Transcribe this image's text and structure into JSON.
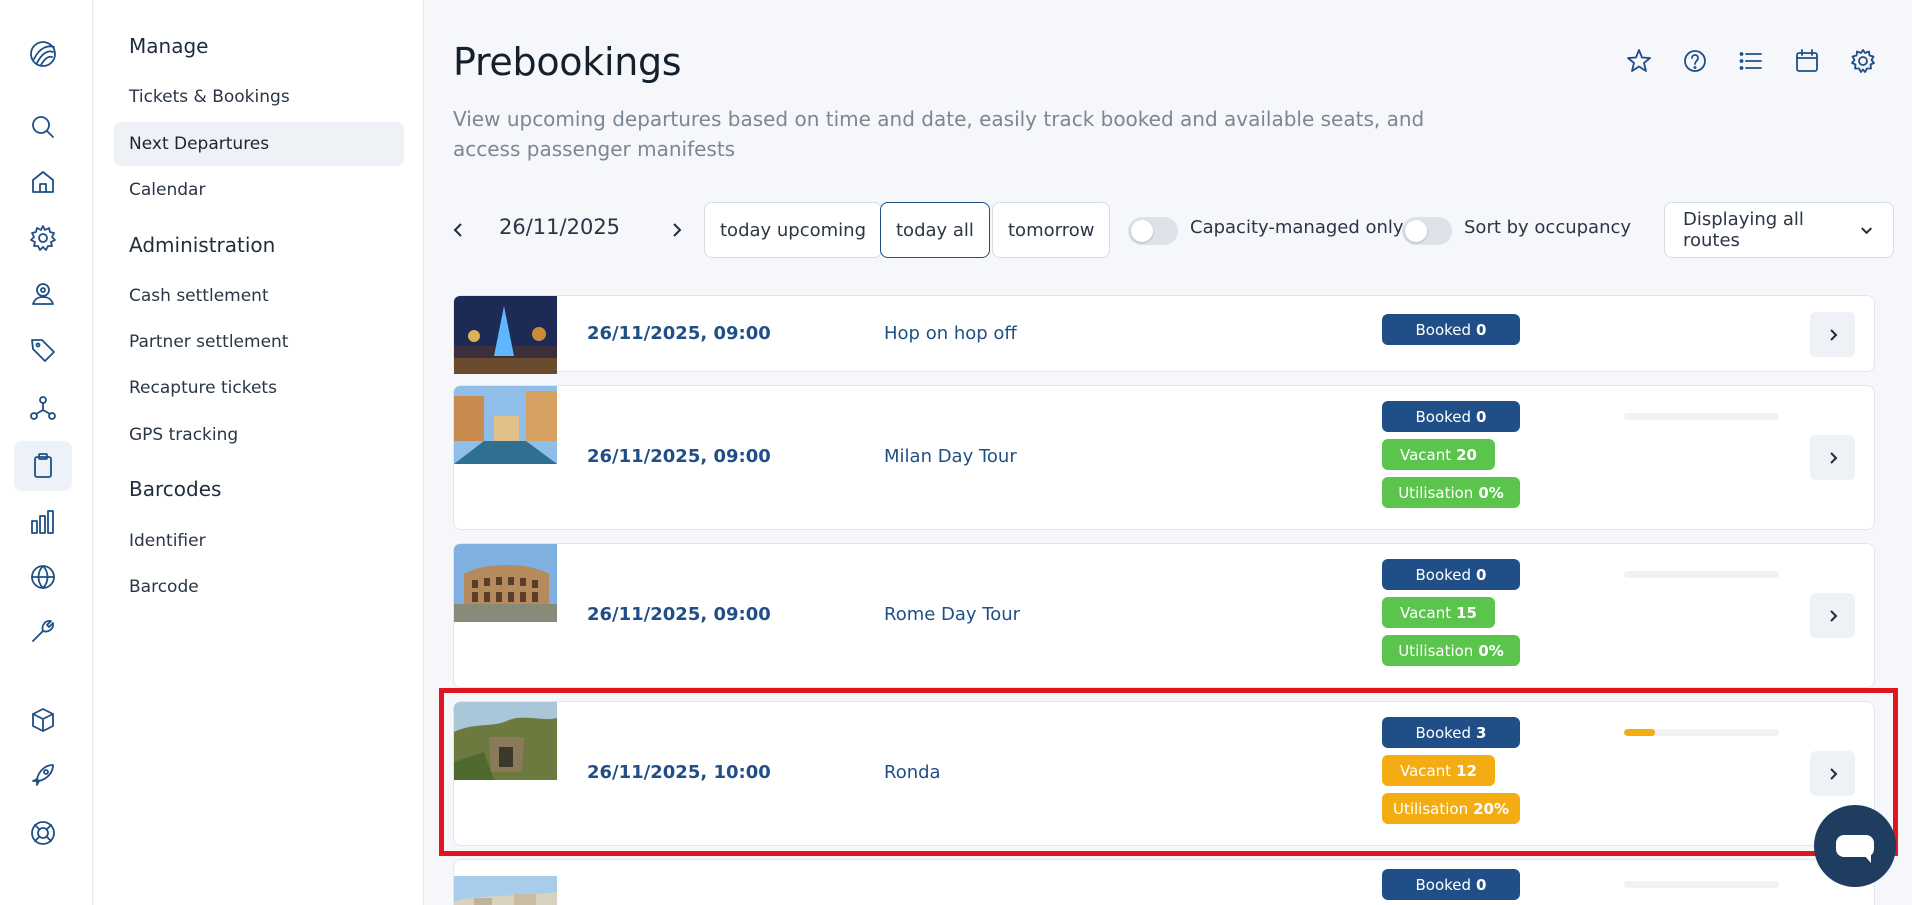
{
  "rail": {
    "icons": [
      "logo-icon",
      "search-icon",
      "home-icon",
      "gear-icon",
      "user-pin-icon",
      "tag-icon",
      "network-icon",
      "clipboard-icon",
      "bar-chart-icon",
      "globe-icon",
      "wrench-icon",
      "cube-icon",
      "rocket-icon",
      "lifebuoy-icon"
    ],
    "active": "clipboard-icon"
  },
  "sidebar": {
    "sections": [
      {
        "heading": "Manage",
        "items": [
          "Tickets & Bookings",
          "Next Departures",
          "Calendar"
        ]
      },
      {
        "heading": "Administration",
        "items": [
          "Cash settlement",
          "Partner settlement",
          "Recapture tickets",
          "GPS tracking"
        ]
      },
      {
        "heading": "Barcodes",
        "items": [
          "Identifier",
          "Barcode"
        ]
      }
    ],
    "active_item": "Next Departures"
  },
  "header": {
    "title": "Prebookings",
    "subtitle": "View upcoming departures based on time and date, easily track booked and available seats, and access passenger manifests",
    "icons": [
      "star-icon",
      "help-icon",
      "list-icon",
      "calendar-icon",
      "settings-icon"
    ]
  },
  "toolbar": {
    "date": "26/11/2025",
    "quick_buttons": [
      "today upcoming",
      "today all",
      "tomorrow"
    ],
    "selected_quick": "today all",
    "toggle_capacity": "Capacity-managed only",
    "toggle_sort": "Sort by occupancy",
    "route_select": "Displaying all routes"
  },
  "departures": [
    {
      "datetime": "26/11/2025, 09:00",
      "route": "Hop on hop off",
      "booked_label": "Booked",
      "booked": "0"
    },
    {
      "datetime": "26/11/2025, 09:00",
      "route": "Milan Day Tour",
      "booked_label": "Booked",
      "booked": "0",
      "vacant_label": "Vacant",
      "vacant": "20",
      "util_label": "Utilisation",
      "util": "0%",
      "util_fraction": 0.0
    },
    {
      "datetime": "26/11/2025, 09:00",
      "route": "Rome Day Tour",
      "booked_label": "Booked",
      "booked": "0",
      "vacant_label": "Vacant",
      "vacant": "15",
      "util_label": "Utilisation",
      "util": "0%",
      "util_fraction": 0.0
    },
    {
      "datetime": "26/11/2025, 10:00",
      "route": "Ronda",
      "booked_label": "Booked",
      "booked": "3",
      "vacant_label": "Vacant",
      "vacant": "12",
      "util_label": "Utilisation",
      "util": "20%",
      "util_fraction": 0.2
    },
    {
      "booked_label": "Booked",
      "booked": "0"
    }
  ],
  "colors": {
    "brand": "#1f4f86",
    "green": "#5bc44c",
    "amber": "#f3ac12",
    "highlight": "#e0151f"
  }
}
